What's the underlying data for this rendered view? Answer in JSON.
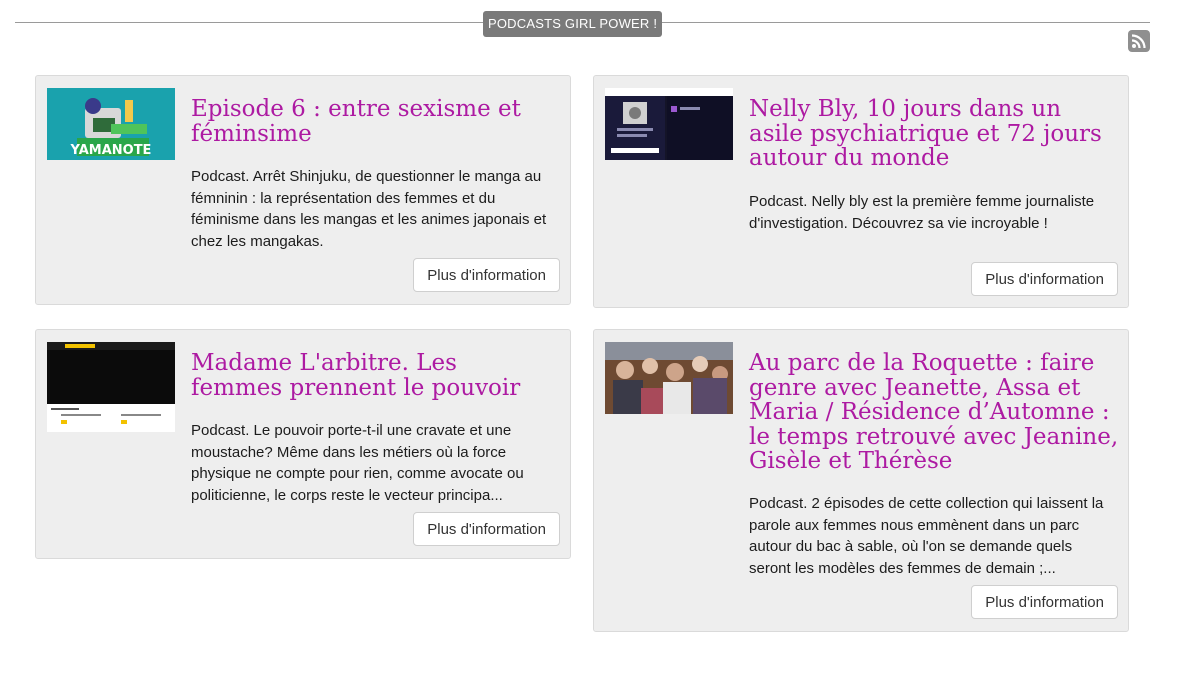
{
  "section": {
    "title": "PODCASTS GIRL POWER !",
    "rss_icon": "rss-feed-icon"
  },
  "cards": [
    {
      "title": "Episode 6 : entre sexisme et féminsime",
      "description": "Podcast. Arrêt Shinjuku, de questionner le manga au fémninin : la représentation des femmes et du féminisme dans les mangas et les animes japonais et chez les mangakas.",
      "button": "Plus d'information",
      "thumb_caption": "YAMANOTE"
    },
    {
      "title": "Nelly Bly, 10 jours dans un asile psychiatrique et 72 jours autour du monde",
      "description": "Podcast. Nelly bly est la première femme journaliste d'investigation. Découvrez sa vie incroyable !",
      "button": "Plus d'information"
    },
    {
      "title": "Madame L'arbitre. Les femmes prennent le pouvoir",
      "description": "Podcast. Le pouvoir porte-t-il une cravate et une moustache? Même dans les métiers où la force physique ne compte pour rien, comme avocate ou politicienne, le corps reste le vecteur principa...",
      "button": "Plus d'information"
    },
    {
      "title": "Au parc de la Roquette : faire genre avec Jeanette, Assa et Maria / Résidence d’Automne : le temps retrouvé avec Jeanine, Gisèle et Thérèse",
      "description": "Podcast. 2 épisodes de cette collection qui laissent la parole aux femmes nous emmènent dans un parc autour du bac à sable, où l'on se demande quels seront les modèles des femmes de demain ;...",
      "button": "Plus d'information"
    }
  ]
}
